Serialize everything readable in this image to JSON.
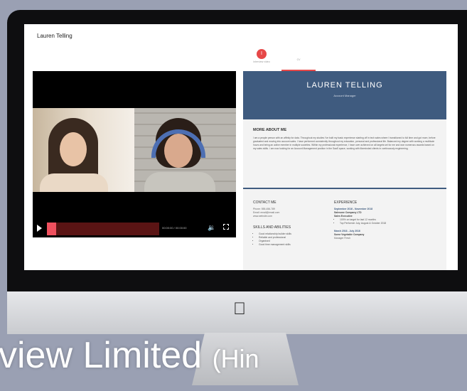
{
  "app": {
    "title": "Lauren Telling"
  },
  "tabs": [
    {
      "label": "Interview video",
      "badge": "I",
      "active": false
    },
    {
      "label": "CV",
      "active": true
    }
  ],
  "video": {
    "progress": 0.08,
    "time": "00:00:00 / 00:00:00"
  },
  "resume": {
    "name": "LAUREN TELLING",
    "role": "Account Manager",
    "about_title": "MORE ABOUT ME",
    "about_text": "I am a people person with an affinity for data. Throughout my studies I've built my basic experience starting off in tech sales where I transitioned to full time and got more, before graduated and moving into account sales. I have performed consistently throughout my education, personal and professional life. Balanced my degree with working a multitude hours and being an active member in multiple societies. Within my professional experience, I have over achieved on all targets set for me and won numerous awards based on my sales skills. I am now looking for an Account Management position in the SaaS space, working with likeminded clients in continuously engineering.",
    "contact": {
      "title": "CONTACT ME",
      "lines": [
        "Phone: 555-456-789",
        "Email: email@email.com",
        "www.website.com"
      ]
    },
    "skills": {
      "title": "SKILLS AND ABILITIES",
      "items": [
        "Good relationship builder skills",
        "Reliable and professional",
        "Organised",
        "Good time management skills"
      ]
    },
    "experience": {
      "title": "EXPERIENCE",
      "jobs": [
        {
          "dates": "September 2016 - November 2018",
          "company": "Salesone Company LTD",
          "position": "Sales Executive",
          "points": [
            "100% on target for last 12 months",
            "Top Performer July, August & October 2018"
          ]
        },
        {
          "dates": "March 2016 - July 2016",
          "company": "Some Vegetable Company",
          "position": "Manager Fresh"
        }
      ]
    }
  },
  "watermark": {
    "main": "view Limited ",
    "suffix": "(Hin"
  },
  "colors": {
    "accent": "#e64848",
    "resume_header": "#3f5b7f",
    "progress": "#f0505e"
  }
}
